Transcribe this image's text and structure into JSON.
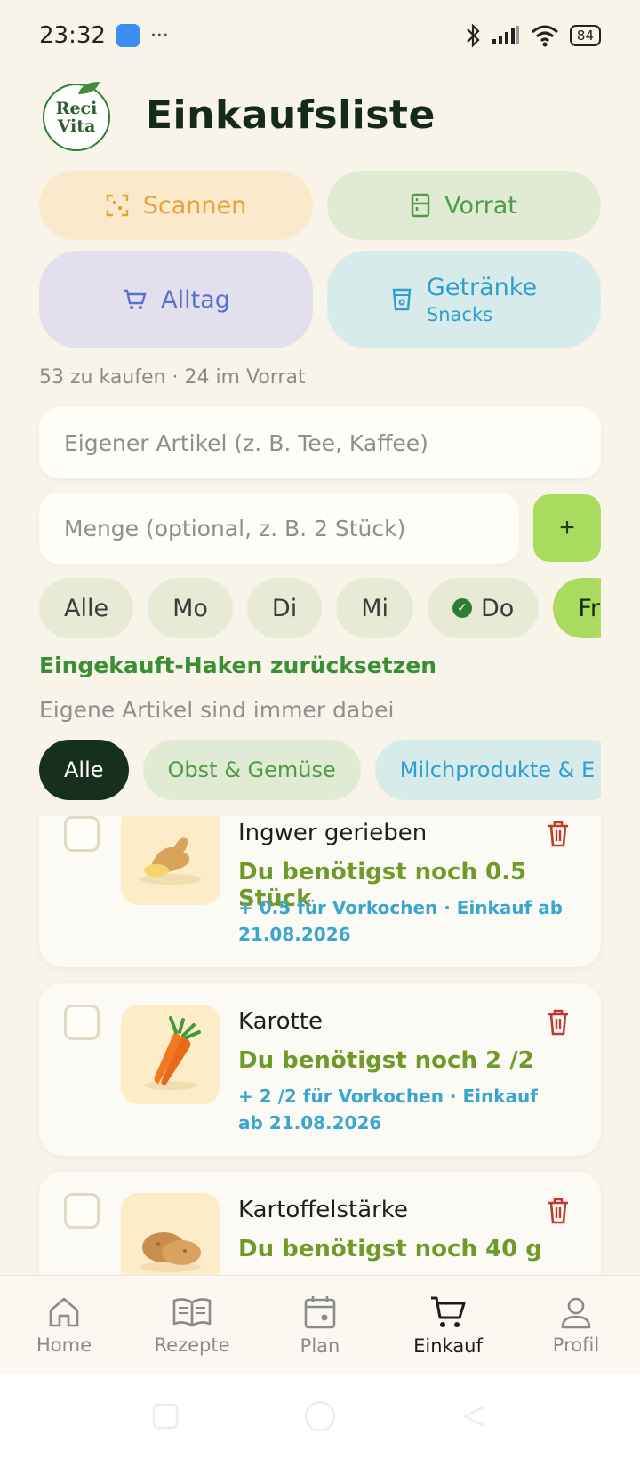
{
  "status_bar": {
    "time": "23:32",
    "more": "···",
    "battery": "84"
  },
  "app": {
    "logo_line1": "Reci",
    "logo_line2": "Vita",
    "title": "Einkaufsliste"
  },
  "categories": {
    "scan": {
      "label": "Scannen",
      "icon": "scan-icon",
      "color": "#e8a23a"
    },
    "vorrat": {
      "label": "Vorrat",
      "icon": "fridge-icon",
      "color": "#4f9c45"
    },
    "alltag": {
      "label": "Alltag",
      "icon": "cart-icon",
      "color": "#5b6fd0"
    },
    "getraenke": {
      "label": "Getränke",
      "sublabel": "Snacks",
      "icon": "cup-icon",
      "color": "#2f9fce"
    }
  },
  "counts": "53 zu kaufen · 24 im Vorrat",
  "inputs": {
    "item_placeholder": "Eigener Artikel (z. B. Tee, Kaffee)",
    "qty_placeholder": "Menge (optional, z. B. 2 Stück)",
    "add_label": "+"
  },
  "days": [
    "Alle",
    "Mo",
    "Di",
    "Mi",
    "Do",
    "Fr"
  ],
  "days_checked": "Do",
  "days_active": "Fr",
  "reset_label": "Eingekauft-Haken zurücksetzen",
  "note": "Eigene Artikel sind immer dabei",
  "filter_chips": [
    "Alle",
    "Obst & Gemüse",
    "Milchprodukte & E"
  ],
  "items": [
    {
      "name": "Ingwer gerieben",
      "need": "Du benötigst noch 0.5 Stück",
      "extra": "+ 0.5 für Vorkochen · Einkauf ab 21.08.2026",
      "icon": "ginger-icon"
    },
    {
      "name": "Karotte",
      "need": "Du benötigst noch 2 /2",
      "extra": "+ 2 /2 für Vorkochen · Einkauf ab 21.08.2026",
      "icon": "carrot-icon"
    },
    {
      "name": "Kartoffelstärke",
      "need": "Du benötigst noch 40 g",
      "extra": "",
      "icon": "potato-icon"
    }
  ],
  "nav": [
    {
      "label": "Home",
      "icon": "home-icon"
    },
    {
      "label": "Rezepte",
      "icon": "book-icon"
    },
    {
      "label": "Plan",
      "icon": "calendar-icon"
    },
    {
      "label": "Einkauf",
      "icon": "cart-icon",
      "active": true
    },
    {
      "label": "Profil",
      "icon": "user-icon"
    }
  ]
}
